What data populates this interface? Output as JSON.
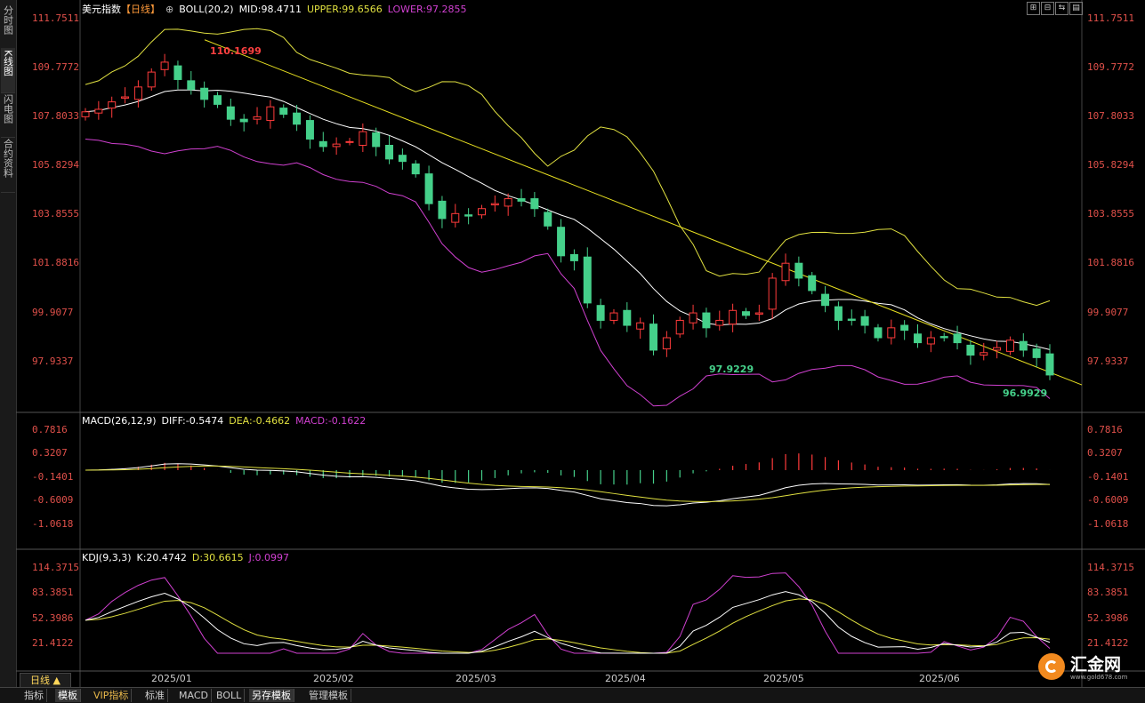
{
  "side_tabs": [
    "分时图",
    "K线图",
    "闪电图",
    "合约资料"
  ],
  "main": {
    "title": "美元指数",
    "period_tag": "【日线】",
    "circle_icon": "⊕",
    "boll_label": "BOLL(20,2)",
    "mid": "MID:98.4711",
    "upper": "UPPER:99.6566",
    "lower": "LOWER:97.2855",
    "y_labels": [
      "111.7511",
      "109.7772",
      "107.8033",
      "105.8294",
      "103.8555",
      "101.8816",
      "99.9077",
      "97.9337"
    ],
    "high_annotation": "110.1699",
    "low_annotation_1": "97.9229",
    "low_annotation_2": "96.9929"
  },
  "macd": {
    "label": "MACD(26,12,9)",
    "diff": "DIFF:-0.5474",
    "dea": "DEA:-0.4662",
    "macd": "MACD:-0.1622",
    "y_labels": [
      "0.7816",
      "0.3207",
      "-0.1401",
      "-0.6009",
      "-1.0618"
    ]
  },
  "kdj": {
    "label": "KDJ(9,3,3)",
    "k": "K:20.4742",
    "d": "D:30.6615",
    "j": "J:0.0997",
    "y_labels": [
      "114.3715",
      "83.3851",
      "52.3986",
      "21.4122"
    ]
  },
  "x_labels": [
    "2025/01",
    "2025/02",
    "2025/03",
    "2025/04",
    "2025/05",
    "2025/06"
  ],
  "period_button": "日线 ▲",
  "toolbar": [
    "指标",
    "模板",
    "VIP指标",
    "标准",
    "MACD",
    "BOLL",
    "另存模板",
    "管理模板"
  ],
  "window_controls": [
    "⊞",
    "⊟",
    "⇆",
    "▤",
    "▦"
  ],
  "logo": {
    "name": "汇金网",
    "url": "www.gold678.com"
  },
  "colors": {
    "up": "#ff3b3b",
    "down": "#45d08a",
    "upper": "#e0e040",
    "mid": "#ffffff",
    "lower": "#d040d0",
    "axis": "#e0504a"
  },
  "chart_data": {
    "type": "candlestick",
    "title": "美元指数 日线",
    "close_path": [
      108.0,
      108.1,
      108.4,
      108.6,
      109.0,
      109.6,
      110.0,
      109.3,
      108.9,
      108.5,
      108.3,
      107.7,
      107.6,
      107.8,
      108.2,
      107.9,
      107.5,
      106.9,
      106.6,
      106.7,
      106.8,
      107.2,
      106.6,
      106.1,
      106.0,
      105.5,
      104.3,
      103.7,
      103.9,
      103.8,
      104.1,
      104.3,
      104.5,
      104.4,
      104.1,
      103.4,
      102.2,
      102.0,
      100.3,
      99.6,
      99.9,
      99.4,
      99.5,
      98.4,
      98.9,
      99.6,
      99.9,
      99.3,
      99.6,
      100.0,
      99.8,
      99.9,
      101.3,
      101.9,
      101.3,
      100.8,
      100.2,
      99.6,
      99.6,
      99.4,
      98.9,
      99.3,
      99.2,
      98.7,
      98.9,
      98.9,
      98.7,
      98.2,
      98.3,
      98.5,
      98.8,
      98.4,
      98.1,
      97.4
    ],
    "trendline": {
      "from": 110.9,
      "to": 97.0
    },
    "annotations": [
      "110.1699",
      "97.9229",
      "96.9929"
    ]
  }
}
